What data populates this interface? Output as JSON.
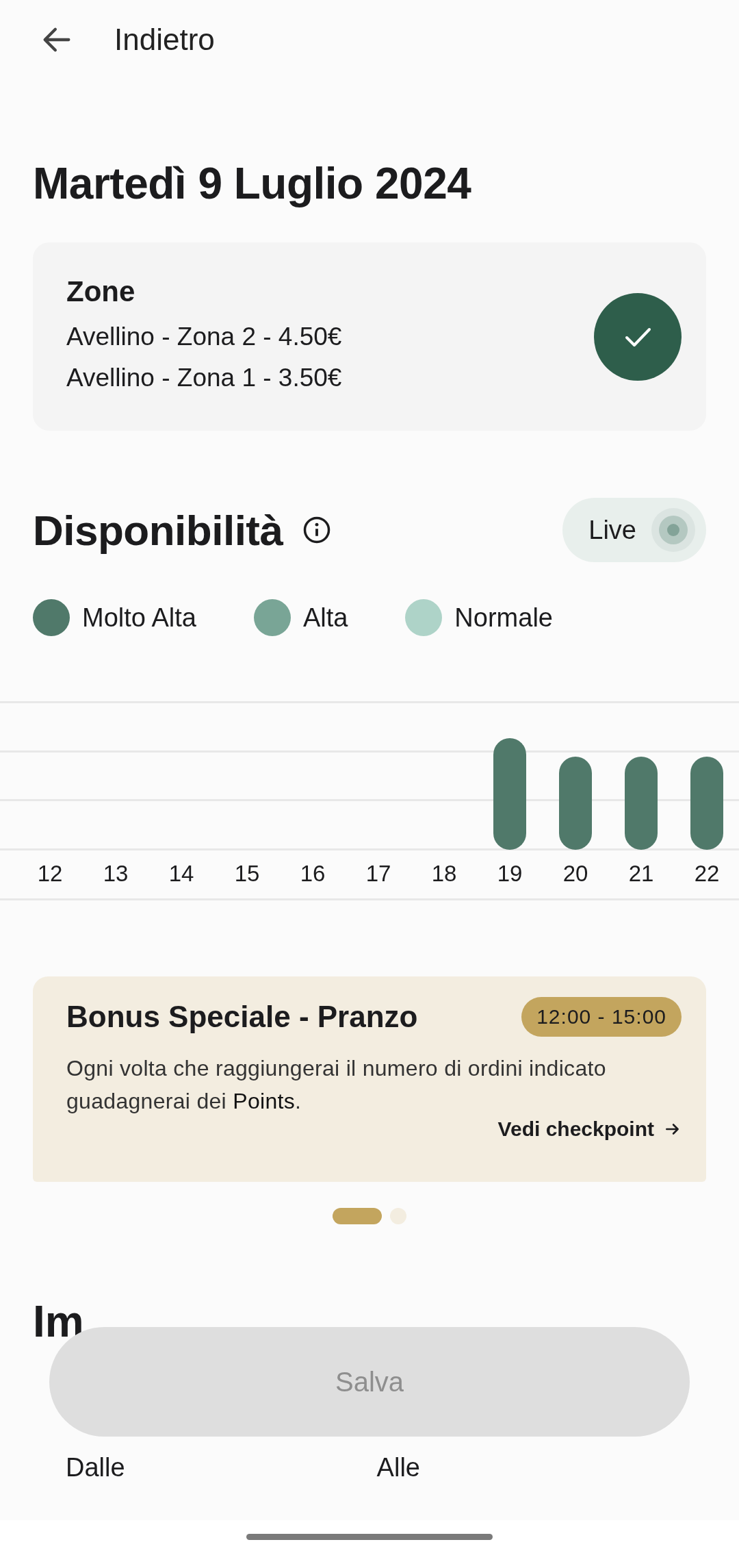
{
  "header": {
    "back_label": "Indietro"
  },
  "date_title": "Martedì 9 Luglio 2024",
  "zones": {
    "title": "Zone",
    "items": [
      "Avellino - Zona 2 - 4.50€",
      "Avellino - Zona 1 - 3.50€"
    ],
    "confirmed": true
  },
  "availability": {
    "title": "Disponibilità",
    "live": {
      "label": "Live",
      "on": false
    },
    "legend": [
      {
        "label": "Molto Alta",
        "color": "#50796a"
      },
      {
        "label": "Alta",
        "color": "#79a596"
      },
      {
        "label": "Normale",
        "color": "#aed3c8"
      }
    ],
    "hours": [
      {
        "label": "12",
        "kind": "empty"
      },
      {
        "label": "13",
        "kind": "empty"
      },
      {
        "label": "14",
        "kind": "empty"
      },
      {
        "label": "15",
        "kind": "empty"
      },
      {
        "label": "16",
        "kind": "empty"
      },
      {
        "label": "17",
        "kind": "empty"
      },
      {
        "label": "18",
        "kind": "empty"
      },
      {
        "label": "19",
        "kind": "peak"
      },
      {
        "label": "20",
        "kind": "bar"
      },
      {
        "label": "21",
        "kind": "bar"
      },
      {
        "label": "22",
        "kind": "bar"
      }
    ]
  },
  "bonus": {
    "title": "Bonus Speciale - Pranzo",
    "time": "12:00 - 15:00",
    "description": "Ogni volta che raggiungerai il numero di ordini indicato guadagnerai dei **Points**.",
    "link": "Vedi checkpoint"
  },
  "pager": [
    {
      "selected": true
    },
    {
      "selected": false
    }
  ],
  "schedule": {
    "title": "Im",
    "from_label": "Dalle",
    "to_label": "Alle"
  },
  "save_button": {
    "label": "Salva",
    "disabled": true
  }
}
